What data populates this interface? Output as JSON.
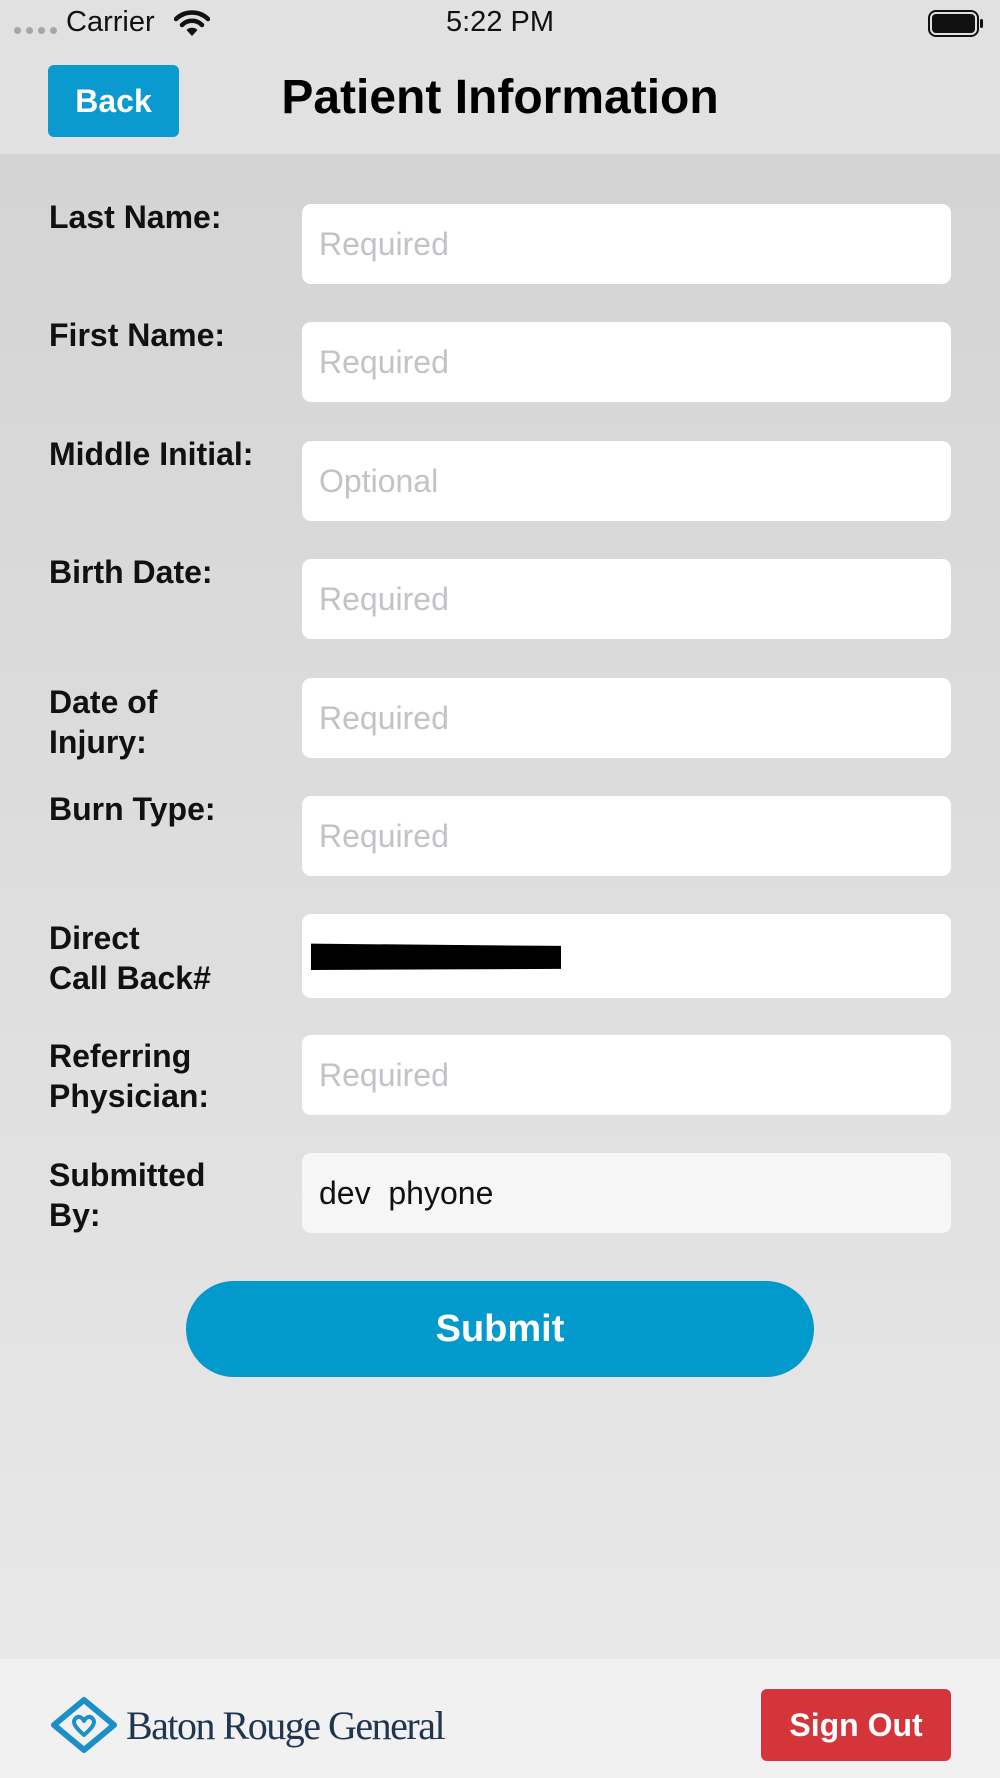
{
  "status_bar": {
    "carrier": "Carrier",
    "time": "5:22 PM",
    "icons": [
      "signal-dots-icon",
      "wifi-icon",
      "battery-icon"
    ]
  },
  "header": {
    "back_label": "Back",
    "title": "Patient Information"
  },
  "form": {
    "last_name": {
      "label": "Last Name:",
      "placeholder": "Required",
      "value": ""
    },
    "first_name": {
      "label": "First Name:",
      "placeholder": "Required",
      "value": ""
    },
    "middle_initial": {
      "label": "Middle Initial:",
      "placeholder": "Optional",
      "value": ""
    },
    "birth_date": {
      "label": "Birth Date:",
      "placeholder": "Required",
      "value": ""
    },
    "date_of_injury": {
      "label_line1": "Date of",
      "label_line2": "Injury:",
      "placeholder": "Required",
      "value": ""
    },
    "burn_type": {
      "label": "Burn Type:",
      "placeholder": "Required",
      "value": ""
    },
    "direct_call_back": {
      "label_line1": "Direct",
      "label_line2": "Call Back#",
      "value": "[redacted]"
    },
    "referring_physician": {
      "label_line1": "Referring",
      "label_line2": "Physician:",
      "placeholder": "Required",
      "value": ""
    },
    "submitted_by": {
      "label_line1": "Submitted",
      "label_line2": "By:",
      "value": "dev  phyone"
    },
    "submit_label": "Submit"
  },
  "footer": {
    "logo_text": "Baton Rouge General",
    "sign_out_label": "Sign Out"
  },
  "colors": {
    "accent_blue": "#0299cc",
    "sign_out_red": "#d3353a",
    "logo_navy": "#1f3550",
    "logo_blue": "#1a8fc8"
  }
}
